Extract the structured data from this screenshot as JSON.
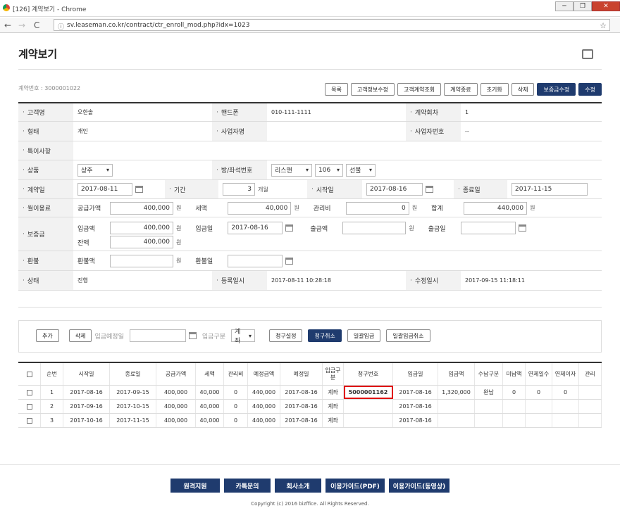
{
  "window": {
    "title": "[126] 계약보기 - Chrome",
    "minimize": "─",
    "restore": "❐",
    "close": "✕"
  },
  "browser": {
    "url": "sv.leaseman.co.kr/contract/ctr_enroll_mod.php?idx=1023",
    "back": "←",
    "forward": "→",
    "reload": "C",
    "info": "ⓘ",
    "star": "☆"
  },
  "page": {
    "title": "계약보기",
    "contract_no": "계약번호 : 3000001022"
  },
  "toolbar": [
    "목록",
    "고객정보수정",
    "고객계약조회",
    "계약종료",
    "초기화",
    "삭제",
    "보증금수정",
    "수정"
  ],
  "form": {
    "customer_label": "고객명",
    "customer": "오한솔",
    "phone_label": "핸드폰",
    "phone": "010-111-1111",
    "count_label": "계약회차",
    "count": "1",
    "type_label": "형태",
    "type": "개인",
    "biz_label": "사업자명",
    "biz": "",
    "bizno_label": "사업자번호",
    "bizno": "--",
    "special_label": "특이사항",
    "product_label": "상품",
    "product": "상주",
    "room_label": "방/좌석번호",
    "room_sel1": "리스맨",
    "room_sel2": "106",
    "room_sel3": "선불",
    "contract_date_label": "계약일",
    "contract_date": "2017-08-11",
    "period_label": "기간",
    "period": "3",
    "period_unit": "개월",
    "start_label": "시작일",
    "start": "2017-08-16",
    "end_label": "종료일",
    "end": "2017-11-15",
    "monthly_label": "월이용료",
    "supply_label": "공급가액",
    "supply": "400,000",
    "tax_label": "세액",
    "tax": "40,000",
    "mgmt_label": "관리비",
    "mgmt": "0",
    "total_label": "합계",
    "total": "440,000",
    "won": "원",
    "deposit_label": "보증금",
    "dep_in_label": "입금액",
    "dep_in": "400,000",
    "dep_in_date_label": "입금일",
    "dep_in_date": "2017-08-16",
    "dep_out_label": "출금액",
    "dep_out": "",
    "dep_out_date_label": "출금일",
    "dep_out_date": "",
    "balance_label": "잔액",
    "balance": "400,000",
    "refund_label": "환불",
    "refund_amt_label": "환불액",
    "refund_amt": "",
    "refund_date_label": "환불일",
    "refund_date": "",
    "status_label": "상태",
    "status": "진행",
    "reg_label": "등록일시",
    "reg": "2017-08-11 10:28:18",
    "mod_label": "수정일시",
    "mod": "2017-09-15 11:18:11"
  },
  "billing": {
    "add": "추가",
    "delete": "삭제",
    "due_label": "입금예정일",
    "method_label": "입금구분",
    "method": "계좌",
    "b1": "청구설정",
    "b2": "청구취소",
    "b3": "일괄입금",
    "b4": "일괄입금취소"
  },
  "table": {
    "headers": [
      "",
      "순번",
      "시작일",
      "종료일",
      "공급가액",
      "세액",
      "관리비",
      "예정금액",
      "예정일",
      "입금구분",
      "청구번호",
      "입금일",
      "입금액",
      "수납구분",
      "미납액",
      "연체일수",
      "연체이자",
      "관리"
    ],
    "rows": [
      [
        "",
        "1",
        "2017-08-16",
        "2017-09-15",
        "400,000",
        "40,000",
        "0",
        "440,000",
        "2017-08-16",
        "계좌",
        "5000001162",
        "2017-08-16",
        "1,320,000",
        "완납",
        "0",
        "0",
        "0",
        ""
      ],
      [
        "",
        "2",
        "2017-09-16",
        "2017-10-15",
        "400,000",
        "40,000",
        "0",
        "440,000",
        "2017-08-16",
        "계좌",
        "",
        "2017-08-16",
        "",
        "",
        "",
        "",
        "",
        ""
      ],
      [
        "",
        "3",
        "2017-10-16",
        "2017-11-15",
        "400,000",
        "40,000",
        "0",
        "440,000",
        "2017-08-16",
        "계좌",
        "",
        "2017-08-16",
        "",
        "",
        "",
        "",
        "",
        ""
      ]
    ]
  },
  "footer": {
    "buttons": [
      "원격지원",
      "카톡문의",
      "회사소개",
      "이용가이드(PDF)",
      "이용가이드(동영상)"
    ],
    "copyright": "Copyright (c) 2016 bizffice. All Rights Reserved."
  }
}
